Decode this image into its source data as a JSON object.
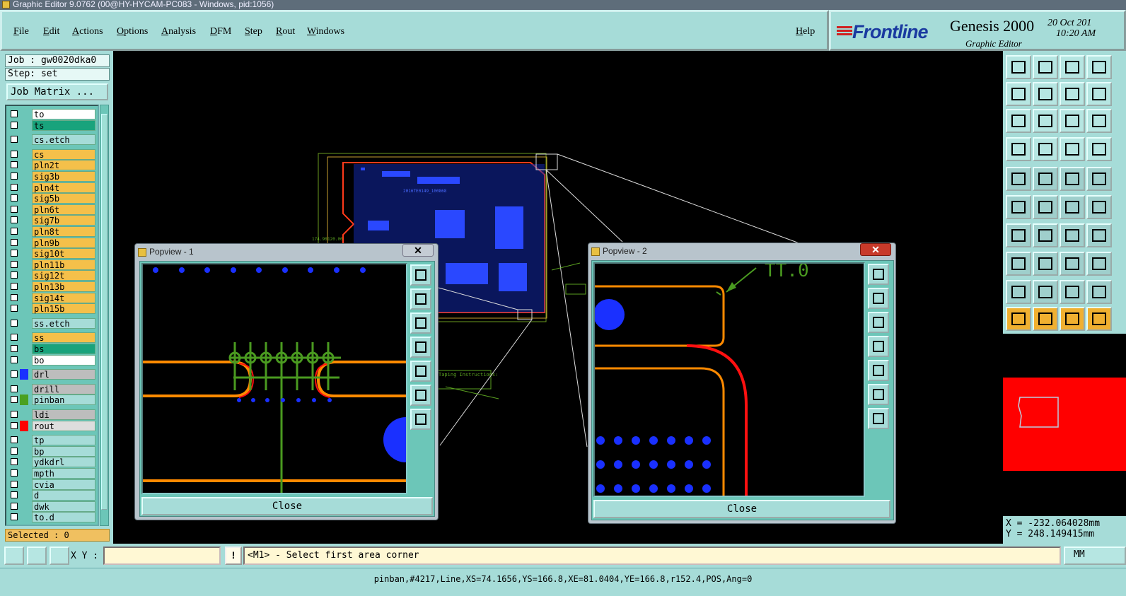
{
  "window": {
    "title": "Graphic Editor 9.0762 (00@HY-HYCAM-PC083 - Windows, pid:1056)"
  },
  "menu": {
    "items": [
      "File",
      "Edit",
      "Actions",
      "Options",
      "Analysis",
      "DFM",
      "Step",
      "Rout",
      "Windows"
    ],
    "help": "Help"
  },
  "brand": {
    "logo": "Frontline",
    "product": "Genesis 2000",
    "subtitle": "Graphic Editor",
    "date": "20 Oct 201",
    "time": "10:20 AM"
  },
  "job": {
    "job_label": "Job : gw0020dka0",
    "step_label": "Step: set",
    "matrix_button": "Job Matrix ..."
  },
  "layers": [
    {
      "name": "to",
      "color": "#ffffff"
    },
    {
      "name": "ts",
      "color": "#19a37c"
    },
    {
      "name": "cs.etch",
      "color": "#a6dcd8"
    },
    {
      "name": "cs",
      "color": "#f5c04a"
    },
    {
      "name": "pln2t",
      "color": "#f5c04a"
    },
    {
      "name": "sig3b",
      "color": "#f5c04a"
    },
    {
      "name": "pln4t",
      "color": "#f5c04a"
    },
    {
      "name": "sig5b",
      "color": "#f5c04a"
    },
    {
      "name": "pln6t",
      "color": "#f5c04a"
    },
    {
      "name": "sig7b",
      "color": "#f5c04a"
    },
    {
      "name": "pln8t",
      "color": "#f5c04a"
    },
    {
      "name": "pln9b",
      "color": "#f5c04a"
    },
    {
      "name": "sig10t",
      "color": "#f5c04a"
    },
    {
      "name": "pln11b",
      "color": "#f5c04a"
    },
    {
      "name": "sig12t",
      "color": "#f5c04a"
    },
    {
      "name": "pln13b",
      "color": "#f5c04a"
    },
    {
      "name": "sig14t",
      "color": "#f5c04a"
    },
    {
      "name": "pln15b",
      "color": "#f5c04a"
    },
    {
      "name": "ss.etch",
      "color": "#a6dcd8"
    },
    {
      "name": "ss",
      "color": "#f5c04a"
    },
    {
      "name": "bs",
      "color": "#19a37c"
    },
    {
      "name": "bo",
      "color": "#ffffff"
    },
    {
      "name": "drl",
      "color": "#bdbdbd"
    },
    {
      "name": "drill",
      "color": "#bdbdbd"
    },
    {
      "name": "pinban",
      "color": "#a6dcd8"
    },
    {
      "name": "ldi",
      "color": "#bdbdbd"
    },
    {
      "name": "rout",
      "color": "#dddddd"
    },
    {
      "name": "tp",
      "color": "#a6dcd8"
    },
    {
      "name": "bp",
      "color": "#a6dcd8"
    },
    {
      "name": "ydkdrl",
      "color": "#a6dcd8"
    },
    {
      "name": "mpth",
      "color": "#a6dcd8"
    },
    {
      "name": "cvia",
      "color": "#a6dcd8"
    },
    {
      "name": "d",
      "color": "#a6dcd8"
    },
    {
      "name": "dwk",
      "color": "#a6dcd8"
    },
    {
      "name": "to.d",
      "color": "#a6dcd8"
    }
  ],
  "selected_label": "Selected : 0",
  "canvas_text": {
    "dim1": "174.90",
    "dim2": "120.00",
    "board_label": "2016TE0149_100868",
    "taping": "Taping Instructions:"
  },
  "popview1": {
    "title": "Popview - 1",
    "close": "Close"
  },
  "popview2": {
    "title": "Popview - 2",
    "close": "Close"
  },
  "coords": {
    "x": "X = -232.064028mm",
    "y": "Y =  248.149415mm"
  },
  "command": {
    "xy_label": "X Y :",
    "xy_value": "",
    "warn": "!",
    "prompt": "<M1> - Select first area corner",
    "unit": "MM"
  },
  "status": "pinban,#4217,Line,XS=74.1656,YS=166.8,XE=81.0404,YE=166.8,r152.4,POS,Ang=0",
  "colors": {
    "panel": "#a6dcd8",
    "layer_accent": "#f5c04a",
    "highlight": "#19a37c",
    "trace_red": "#ff1010",
    "trace_orange": "#ff8a00",
    "pad_blue": "#1a30ff",
    "outline_green": "#4a9a20"
  }
}
